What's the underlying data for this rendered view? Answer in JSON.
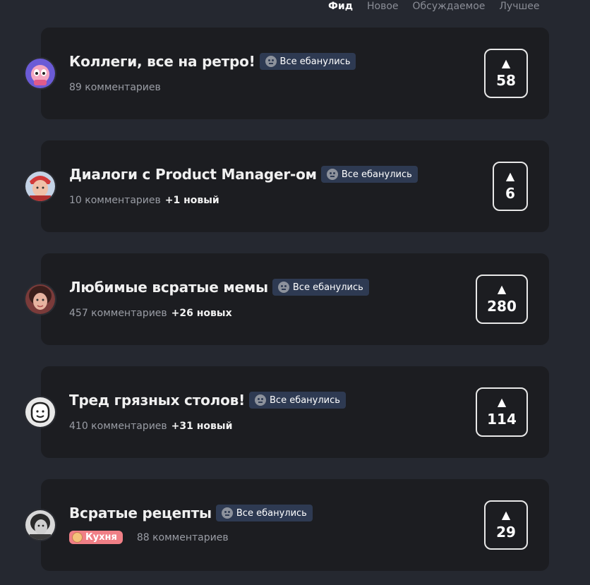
{
  "tabs": [
    {
      "label": "Фид",
      "active": true
    },
    {
      "label": "Новое",
      "active": false
    },
    {
      "label": "Обсуждаемое",
      "active": false
    },
    {
      "label": "Лучшее",
      "active": false
    }
  ],
  "tag_label": "Все ебанулись",
  "posts": [
    {
      "title": "Коллеги, все на ретро!",
      "tag": "Все ебанулись",
      "comments": "89 комментариев",
      "new": "",
      "votes": "58",
      "vote_arrow": "▲"
    },
    {
      "title": "Диалоги с Product Manager-ом",
      "tag": "Все ебанулись",
      "comments": "10 комментариев",
      "new": "+1 новый",
      "votes": "6",
      "vote_arrow": "▲"
    },
    {
      "title": "Любимые всратые мемы",
      "tag": "Все ебанулись",
      "comments": "457 комментариев",
      "new": "+26 новых",
      "votes": "280",
      "vote_arrow": "▲"
    },
    {
      "title": "Тред грязных столов!",
      "tag": "Все ебанулись",
      "comments": "410 комментариев",
      "new": "+31 новый",
      "votes": "114",
      "vote_arrow": "▲"
    },
    {
      "title": "Всратые рецепты",
      "tag": "Все ебанулись",
      "section": "Кухня",
      "comments": "88 комментариев",
      "new": "",
      "votes": "29",
      "vote_arrow": "▲"
    }
  ],
  "colors": {
    "background": "#252830",
    "card": "#1c1d21",
    "tag_bg": "#2e3a52",
    "section_badge": "#f07f86"
  },
  "icons": [
    "neutral-face-icon",
    "cooking-icon",
    "upvote-arrow-icon"
  ]
}
